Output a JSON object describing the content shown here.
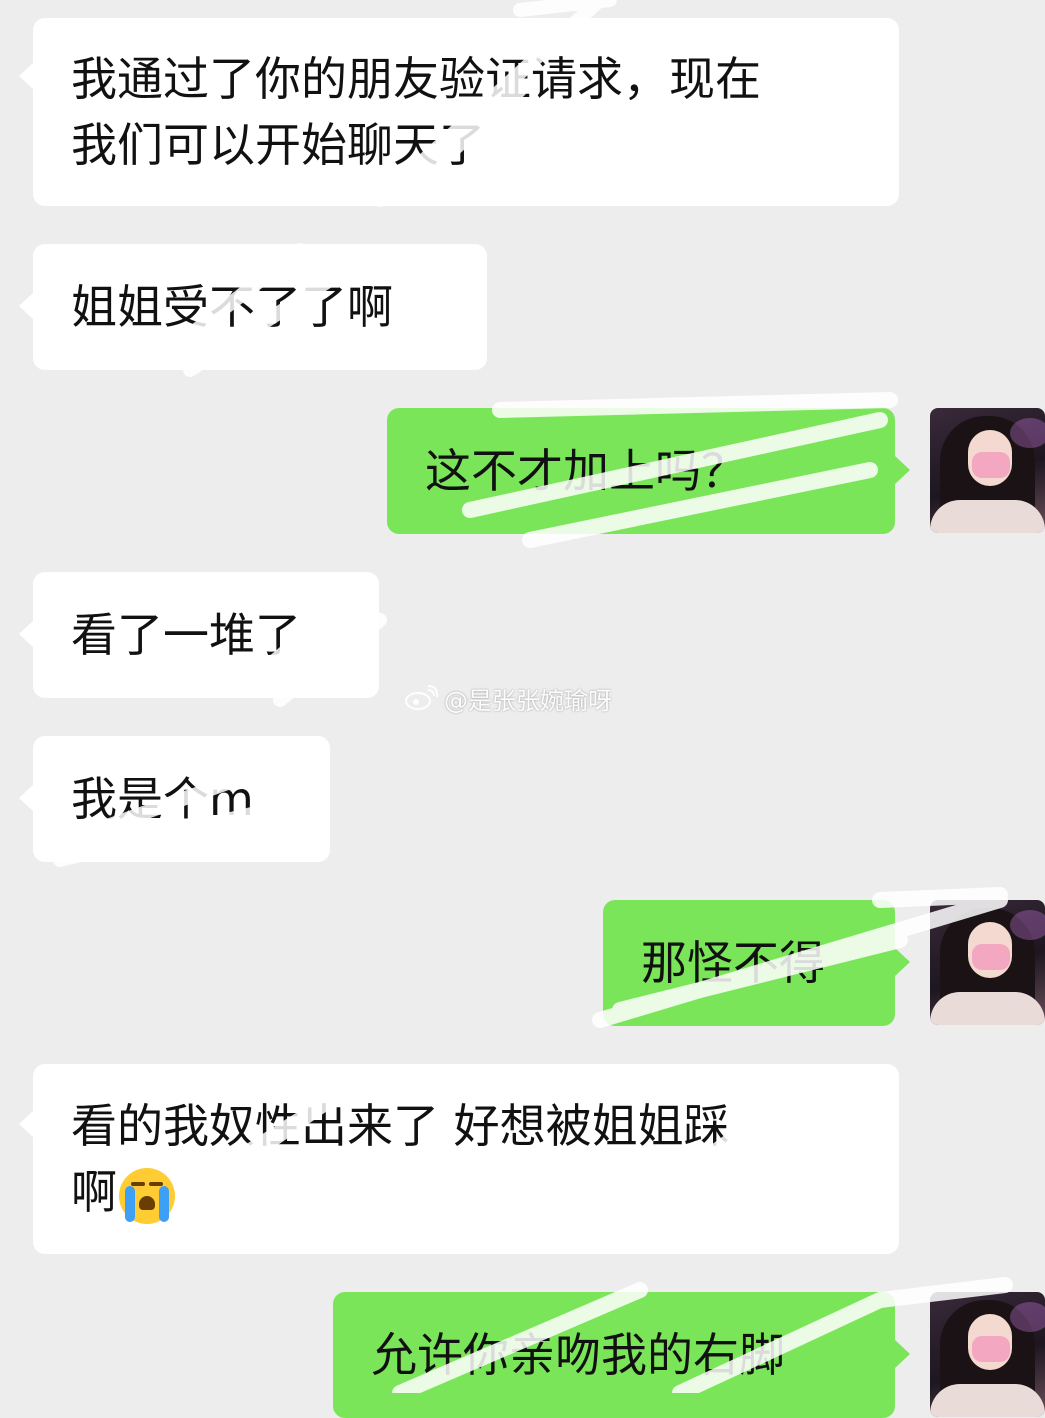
{
  "messages": [
    {
      "side": "in",
      "text": "我通过了你的朋友验证请求，现在\n我们可以开始聊天了"
    },
    {
      "side": "in",
      "text": "姐姐受不了了啊"
    },
    {
      "side": "out",
      "text": "这不才加上吗？"
    },
    {
      "side": "in",
      "text": "看了一堆了"
    },
    {
      "side": "in",
      "text": "我是个m"
    },
    {
      "side": "out",
      "text": "那怪不得"
    },
    {
      "side": "in",
      "text": "看的我奴性出来了 好想被姐姐踩\n啊",
      "emoji": "loudly-crying-face"
    },
    {
      "side": "out",
      "text": "允许你亲吻我的右脚"
    }
  ],
  "watermark": {
    "text": "@是张张婉瑜呀",
    "icon": "weibo-icon"
  },
  "colors": {
    "background": "#ededed",
    "incoming_bubble": "#ffffff",
    "outgoing_bubble": "#7be55a"
  }
}
